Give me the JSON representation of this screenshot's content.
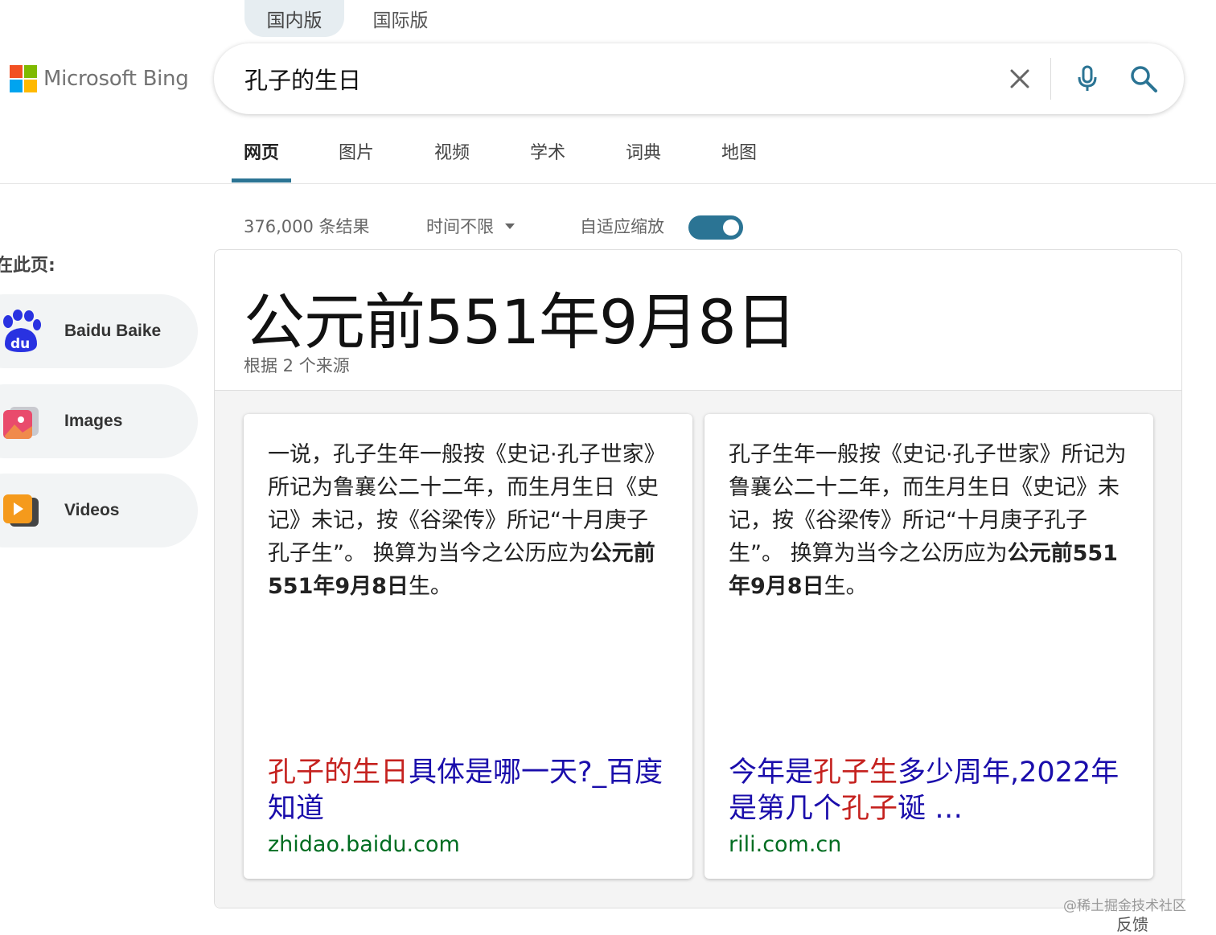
{
  "region_tabs": {
    "domestic": "国内版",
    "international": "国际版"
  },
  "logo": {
    "text": "Microsoft Bing",
    "colors": [
      "#f25022",
      "#7fba00",
      "#00a4ef",
      "#ffb900"
    ]
  },
  "search": {
    "query": "孔子的生日"
  },
  "nav_tabs": [
    {
      "label": "网页",
      "active": true
    },
    {
      "label": "图片"
    },
    {
      "label": "视频"
    },
    {
      "label": "学术"
    },
    {
      "label": "词典"
    },
    {
      "label": "地图"
    }
  ],
  "results_bar": {
    "count": "376,000 条结果",
    "time_filter": "时间不限",
    "adaptive_label": "自适应缩放",
    "adaptive_on": true
  },
  "sidebar": {
    "heading": "在此页:",
    "items": [
      {
        "label": "Baidu Baike",
        "icon": "baidu-icon"
      },
      {
        "label": "Images",
        "icon": "images-icon"
      },
      {
        "label": "Videos",
        "icon": "videos-icon"
      }
    ]
  },
  "answer": {
    "title": "公元前551年9月8日",
    "subtitle": "根据 2 个来源",
    "sources": [
      {
        "text_before": "一说，孔子生年一般按《史记·孔子世家》所记为鲁襄公二十二年，而生月生日《史记》未记，按《谷梁传》所记“十月庚子孔子生”。 换算为当今之公历应为",
        "text_bold": "公元前551年9月8日",
        "text_after": "生。",
        "title_hl": "孔子的生日",
        "title_rest": "具体是哪一天?_百度知道",
        "url": "zhidao.baidu.com"
      },
      {
        "text_before": "孔子生年一般按《史记·孔子世家》所记为鲁襄公二十二年，而生月生日《史记》未记，按《谷梁传》所记“十月庚子孔子生”。 换算为当今之公历应为",
        "text_bold": "公元前551年9月8日",
        "text_after": "生。",
        "title_a": "今年是",
        "title_hl1": "孔子生",
        "title_b": "多少周年,2022年是第几个",
        "title_hl2": "孔子",
        "title_c": "诞 …",
        "url": "rili.com.cn"
      }
    ]
  },
  "footer": {
    "watermark": "@稀土掘金技术社区",
    "feedback": "反馈"
  },
  "colors": {
    "accent": "#2b7494",
    "link": "#1a0dab",
    "highlight": "#c5221f",
    "url": "#006d21"
  }
}
